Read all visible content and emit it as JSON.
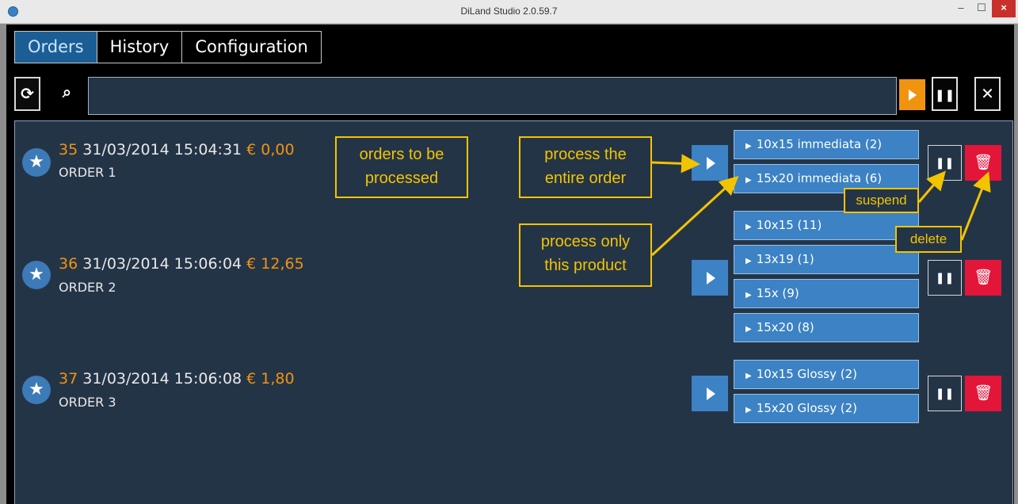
{
  "window": {
    "title": "DiLand Studio 2.0.59.7",
    "min_glyph": "–",
    "max_glyph": "☐",
    "close_glyph": "×"
  },
  "tabs": [
    {
      "label": "Orders"
    },
    {
      "label": "History"
    },
    {
      "label": "Configuration"
    }
  ],
  "toolbar": {
    "refresh_glyph": "⟳",
    "search_glyph": "⌕",
    "search_value": "",
    "pause_glyph": "❚❚",
    "close_glyph": "✕"
  },
  "orders": [
    {
      "number": "35",
      "datetime": "31/03/2014 15:04:31",
      "amount": "€ 0,00",
      "name": "ORDER 1",
      "products": [
        "10x15 immediata (2)",
        "15x20 immediata (6)"
      ]
    },
    {
      "number": "36",
      "datetime": "31/03/2014 15:06:04",
      "amount": "€ 12,65",
      "name": "ORDER 2",
      "products": [
        "10x15 (11)",
        "13x19 (1)",
        "15x (9)",
        "15x20 (8)"
      ]
    },
    {
      "number": "37",
      "datetime": "31/03/2014 15:06:08",
      "amount": "€ 1,80",
      "name": "ORDER 3",
      "products": [
        "10x15 Glossy (2)",
        "15x20 Glossy (2)"
      ]
    }
  ],
  "icons": {
    "star": "★",
    "product_arrow": "▶",
    "pause": "❚❚",
    "delete": "🗑"
  },
  "annotations": {
    "orders_to_process": [
      "orders to be",
      "processed"
    ],
    "process_entire": [
      "process the",
      "entire order"
    ],
    "process_product": [
      "process only",
      "this product"
    ],
    "suspend": "suspend",
    "delete": "delete"
  },
  "colors": {
    "accent_orange": "#f0940f",
    "accent_blue": "#3c82c4",
    "delete_red": "#e3163a",
    "annotation_yellow": "#f2c400"
  }
}
